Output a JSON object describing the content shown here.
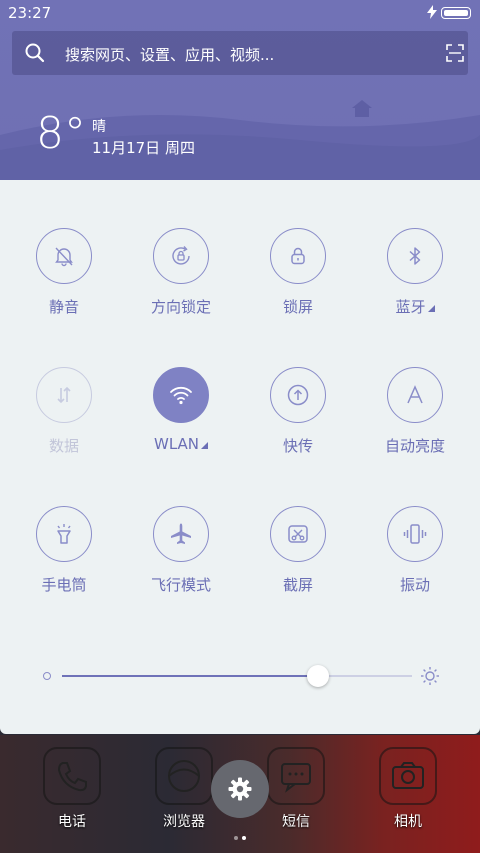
{
  "status_bar": {
    "time": "23:27"
  },
  "search": {
    "placeholder": "搜索网页、设置、应用、视频..."
  },
  "weather": {
    "temperature": "8°",
    "condition": "晴",
    "date": "11月17日 周四"
  },
  "quick_settings": {
    "tiles": [
      {
        "label": "静音",
        "icon": "bell-off-icon",
        "state": "off"
      },
      {
        "label": "方向锁定",
        "icon": "rotation-lock-icon",
        "state": "off"
      },
      {
        "label": "锁屏",
        "icon": "lock-icon",
        "state": "off"
      },
      {
        "label": "蓝牙",
        "icon": "bluetooth-icon",
        "state": "off",
        "expandable": true
      },
      {
        "label": "数据",
        "icon": "mobile-data-icon",
        "state": "disabled"
      },
      {
        "label": "WLAN",
        "icon": "wifi-icon",
        "state": "on",
        "expandable": true
      },
      {
        "label": "快传",
        "icon": "quick-transfer-icon",
        "state": "off"
      },
      {
        "label": "自动亮度",
        "icon": "auto-brightness-icon",
        "state": "off"
      },
      {
        "label": "手电筒",
        "icon": "flashlight-icon",
        "state": "off"
      },
      {
        "label": "飞行模式",
        "icon": "airplane-icon",
        "state": "off"
      },
      {
        "label": "截屏",
        "icon": "screenshot-icon",
        "state": "off"
      },
      {
        "label": "振动",
        "icon": "vibrate-icon",
        "state": "off"
      }
    ],
    "brightness_level": 0.73
  },
  "dock": {
    "apps": [
      "电话",
      "浏览器",
      "短信",
      "相机"
    ],
    "page_count": 2,
    "current_page": 1
  },
  "colors": {
    "accent": "#7f82c4",
    "label": "#6b6fb5",
    "panel": "#edf2f3",
    "top": "#7172b6"
  }
}
